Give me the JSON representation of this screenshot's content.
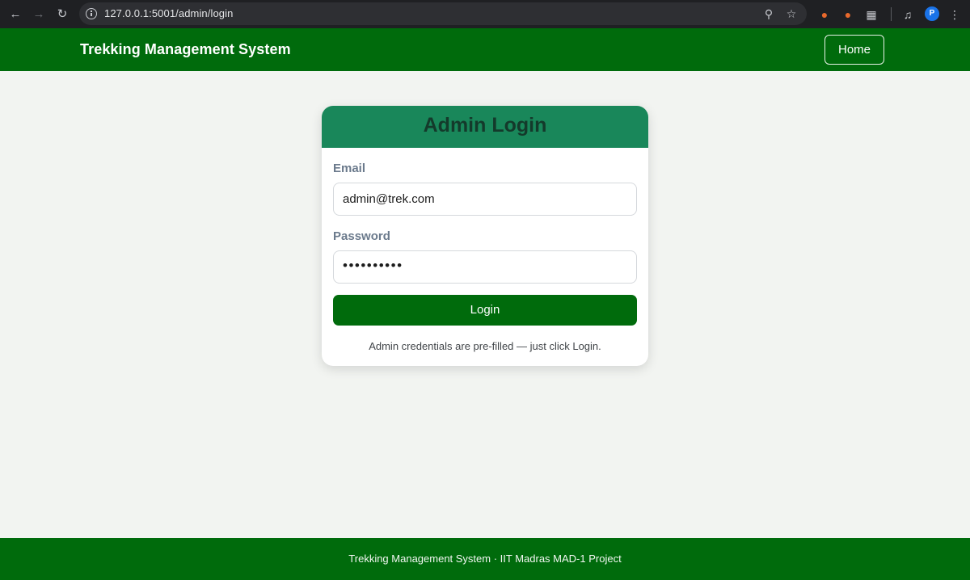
{
  "browser": {
    "url": "127.0.0.1:5001/admin/login",
    "back_icon": "arrow-left-icon",
    "forward_icon": "arrow-right-icon",
    "reload_icon": "reload-icon",
    "profile_initial": "P"
  },
  "navbar": {
    "brand": "Trekking Management System",
    "home_label": "Home"
  },
  "card": {
    "title": "Admin Login",
    "email_label": "Email",
    "email_value": "admin@trek.com",
    "password_label": "Password",
    "password_value": "••••••••••",
    "login_label": "Login",
    "hint": "Admin credentials are pre-filled — just click Login."
  },
  "footer": {
    "text": "Trekking Management System · IIT Madras MAD-1 Project"
  },
  "colors": {
    "brand_green": "#006b0c",
    "card_header": "#19875a",
    "page_bg": "#f2f4f1"
  }
}
